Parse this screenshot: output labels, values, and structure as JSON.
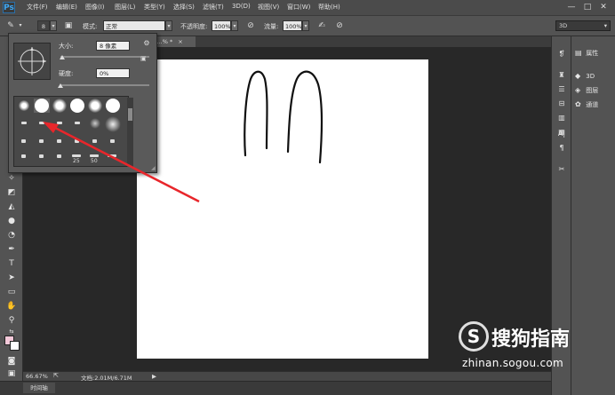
{
  "app": {
    "logo": "Ps"
  },
  "menu": [
    "文件(F)",
    "编辑(E)",
    "图像(I)",
    "图层(L)",
    "类型(Y)",
    "选择(S)",
    "滤镜(T)",
    "3D(D)",
    "视图(V)",
    "窗口(W)",
    "帮助(H)"
  ],
  "window_controls": [
    "—",
    "□",
    "✕"
  ],
  "options_bar": {
    "brush_size": "8",
    "mode_label": "模式:",
    "mode_value": "正常",
    "opacity_label": "不透明度:",
    "opacity_value": "100%",
    "flow_label": "流量:",
    "flow_value": "100%",
    "workspace": "3D"
  },
  "document": {
    "tab_label": "@...% *",
    "close_glyph": "×"
  },
  "brush_popup": {
    "size_label": "大小:",
    "size_value": "8 像素",
    "hardness_label": "硬度:",
    "hardness_value": "0%",
    "size_slider_fraction": 0.02,
    "hardness_slider_fraction": 0.0,
    "preset_labels": [
      "25",
      "50"
    ]
  },
  "status": {
    "zoom": "66.67%",
    "doc_info": "文档:2.01M/6.71M",
    "arrow": "▶"
  },
  "timeline_tab": "时间轴",
  "panels": [
    {
      "icon": "properties-icon",
      "glyph": "▤",
      "label": "属性"
    },
    {
      "icon": "cube-icon",
      "glyph": "◆",
      "label": "3D"
    },
    {
      "icon": "layers-icon",
      "glyph": "◈",
      "label": "图层"
    },
    {
      "icon": "channels-icon",
      "glyph": "✿",
      "label": "通道"
    }
  ],
  "watermark": {
    "logo_letter": "S",
    "name": "搜狗指南",
    "url": "zhinan.sogou.com"
  },
  "annotation": {
    "arrow_color": "#e8262b"
  }
}
